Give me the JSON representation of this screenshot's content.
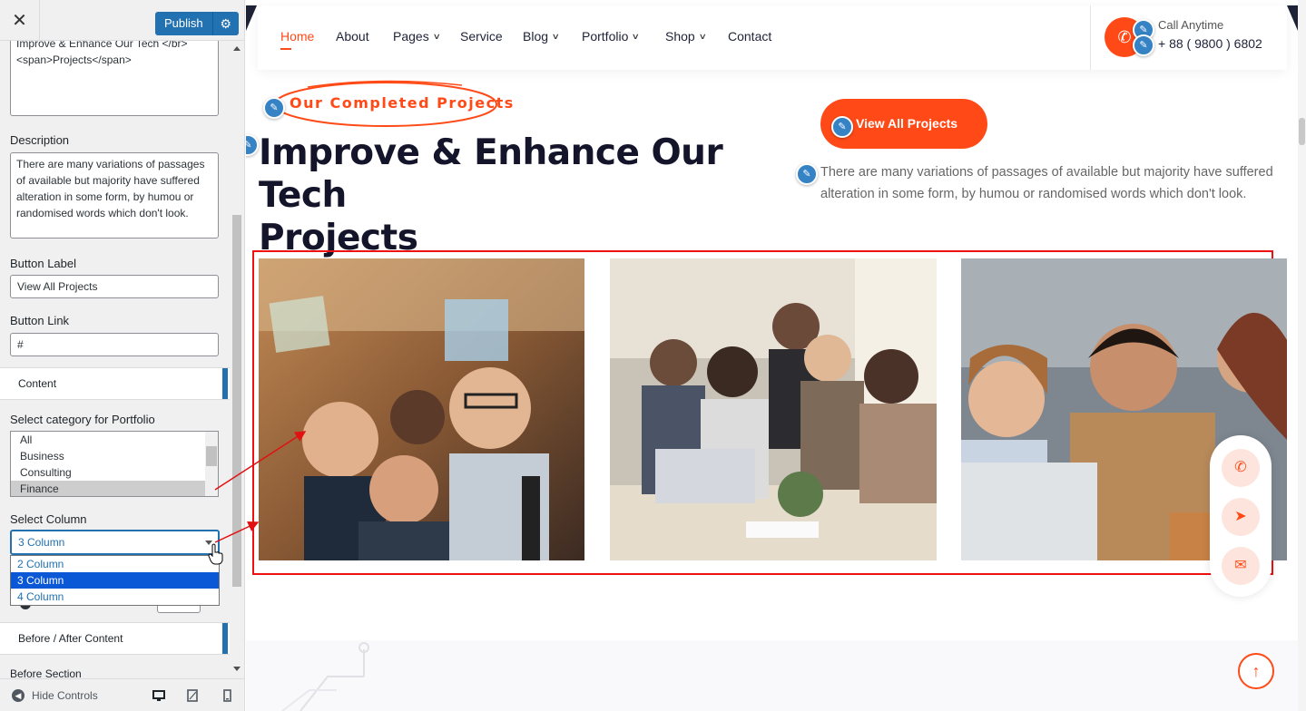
{
  "sidebar": {
    "close_label": "✕",
    "publish_label": "Publish",
    "title_field_value": "Improve & Enhance Our Tech </br>\n<span>Projects</span>",
    "description_label": "Description",
    "description_value": "There are many variations of passages of available but majority have suffered alteration in some form, by humou or randomised words which don't look.",
    "button_label_label": "Button Label",
    "button_label_value": "View All Projects",
    "button_link_label": "Button Link",
    "button_link_value": "#",
    "content_section": "Content",
    "category_label": "Select category for Portfolio",
    "category_options": [
      "All",
      "Business",
      "Consulting",
      "Finance"
    ],
    "category_selected": "Finance",
    "column_label": "Select Column",
    "column_value": "3 Column",
    "column_options": [
      "2 Column",
      "3 Column",
      "4 Column"
    ],
    "before_after_section": "Before / After Content",
    "before_section_label": "Before Section",
    "hide_controls": "Hide Controls"
  },
  "nav": {
    "items": [
      {
        "label": "Home",
        "dropdown": false
      },
      {
        "label": "About",
        "dropdown": false
      },
      {
        "label": "Pages",
        "dropdown": true
      },
      {
        "label": "Service",
        "dropdown": false
      },
      {
        "label": "Blog",
        "dropdown": true
      },
      {
        "label": "Portfolio",
        "dropdown": true
      },
      {
        "label": "Shop",
        "dropdown": true
      },
      {
        "label": "Contact",
        "dropdown": false
      }
    ],
    "active": "Home",
    "call_label": "Call Anytime",
    "phone": "+ 88 ( 9800 ) 6802"
  },
  "section": {
    "subtitle": "Our Completed Projects",
    "title_line1": "Improve & Enhance Our Tech",
    "title_line2": "Projects",
    "button": "View All Projects",
    "description": "There are many variations of passages of available but majority have suffered alteration in some form, by humou or randomised words which don't look."
  },
  "colors": {
    "accent": "#ff4a17",
    "wp_blue": "#2271b1",
    "annotation_red": "#e11111"
  }
}
